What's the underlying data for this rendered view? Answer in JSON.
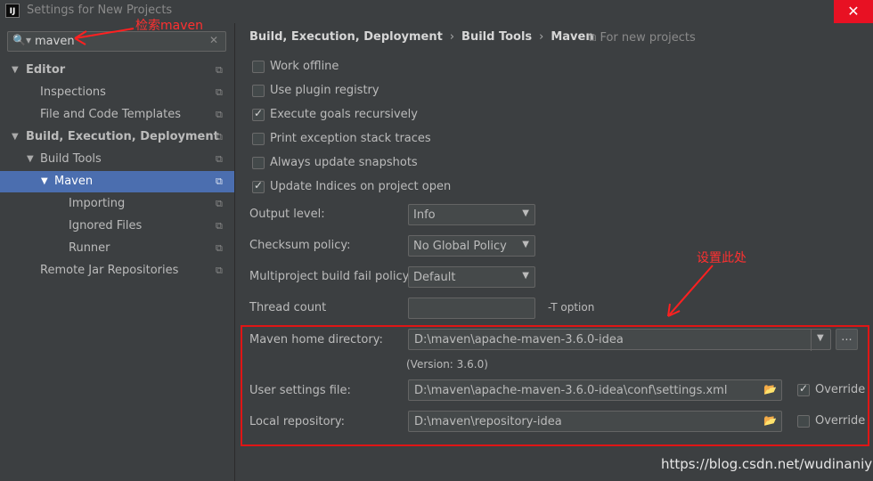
{
  "window": {
    "title": "Settings for New Projects",
    "app_icon": "IJ",
    "close_glyph": "✕"
  },
  "search": {
    "value": "maven",
    "clear_glyph": "✕",
    "search_glyph": "🔍▾"
  },
  "sidebar": {
    "items": [
      {
        "label": "Editor",
        "arrow": "▼",
        "bold": true
      },
      {
        "label": "Inspections"
      },
      {
        "label": "File and Code Templates"
      },
      {
        "label": "Build, Execution, Deployment",
        "arrow": "▼",
        "bold": true
      },
      {
        "label": "Build Tools",
        "arrow": "▼"
      },
      {
        "label": "Maven",
        "arrow": "▼",
        "selected": true
      },
      {
        "label": "Importing"
      },
      {
        "label": "Ignored Files"
      },
      {
        "label": "Runner"
      },
      {
        "label": "Remote Jar Repositories"
      }
    ],
    "copy_glyph": "⧉"
  },
  "breadcrumb": {
    "parts": [
      "Build, Execution, Deployment",
      "Build Tools",
      "Maven"
    ],
    "sep": "›"
  },
  "scope": {
    "icon": "⧉",
    "label": "For new projects"
  },
  "checkboxes": [
    {
      "label": "Work offline",
      "checked": false
    },
    {
      "label": "Use plugin registry",
      "checked": false
    },
    {
      "label": "Execute goals recursively",
      "checked": true
    },
    {
      "label": "Print exception stack traces",
      "checked": false
    },
    {
      "label": "Always update snapshots",
      "checked": false
    },
    {
      "label": "Update Indices on project open",
      "checked": true
    }
  ],
  "check_glyph": "✓",
  "form": {
    "output_level": {
      "label": "Output level:",
      "value": "Info"
    },
    "checksum_policy": {
      "label": "Checksum policy:",
      "value": "No Global Policy"
    },
    "multiproject_policy": {
      "label": "Multiproject build fail policy:",
      "value": "Default"
    },
    "thread_count": {
      "label": "Thread count",
      "value": "",
      "hint": "-T option"
    },
    "maven_home": {
      "label": "Maven home directory:",
      "value": "D:\\maven\\apache-maven-3.6.0-idea",
      "version": "(Version: 3.6.0)",
      "browse": "..."
    },
    "user_settings": {
      "label": "User settings file:",
      "value": "D:\\maven\\apache-maven-3.6.0-idea\\conf\\settings.xml",
      "override_label": "Override",
      "override": true
    },
    "local_repo": {
      "label": "Local repository:",
      "value": "D:\\maven\\repository-idea",
      "override_label": "Override",
      "override": false
    },
    "dropdown_glyph": "▼",
    "folder_glyph": "📂"
  },
  "annotations": {
    "search_note": "检索maven",
    "set_here": "设置此处",
    "color": "#ff2020"
  },
  "watermark": "https://blog.csdn.net/wudinaniya"
}
